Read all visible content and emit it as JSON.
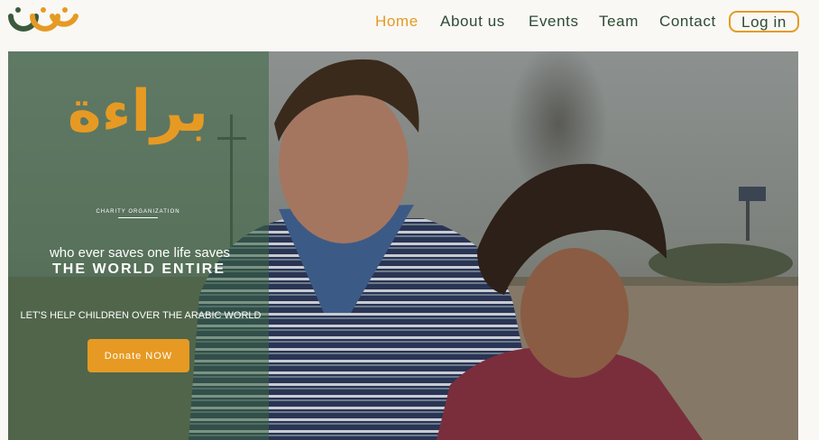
{
  "header": {
    "logo": {
      "icon": "smiling-faces-logo",
      "colors": [
        "#3b5a3d",
        "#e69a23",
        "#e69a23"
      ]
    },
    "nav": {
      "home": "Home",
      "about": "About us",
      "events": "Events",
      "team": "Team",
      "contact": "Contact",
      "login": "Log in"
    }
  },
  "hero": {
    "brand_title": "براءة",
    "org_label": "CHARITY ORGANIZATION",
    "tagline": "who ever saves one life saves",
    "headline": "THE WORLD ENTIRE",
    "subline": "LET'S HELP CHILDREN OVER THE ARABIC WORLD",
    "donate_label": "Donate NOW",
    "photo": "two-children-portrait"
  },
  "colors": {
    "accent": "#e69a23",
    "nav_text": "#2f4a35",
    "overlay": "rgba(58,102,66,0.55)",
    "page_background": "#f9f8f4"
  }
}
